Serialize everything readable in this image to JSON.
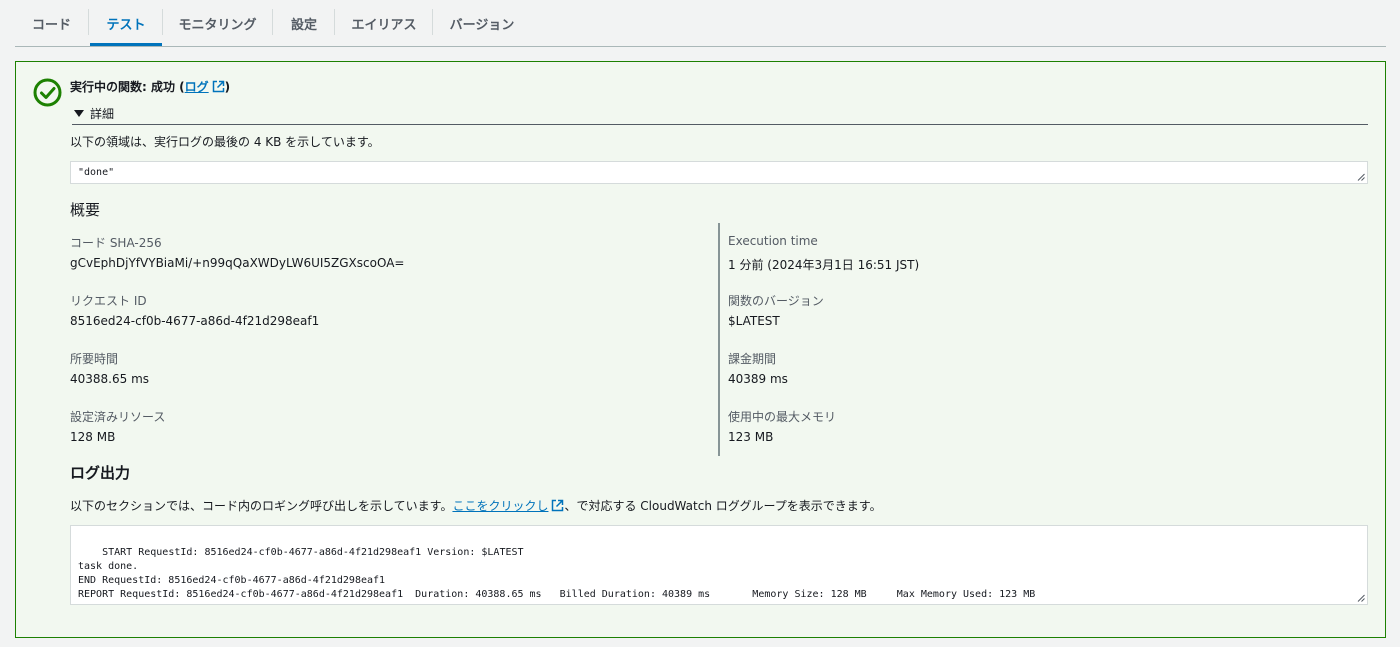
{
  "tabs": [
    {
      "label": "コード",
      "active": false
    },
    {
      "label": "テスト",
      "active": true
    },
    {
      "label": "モニタリング",
      "active": false
    },
    {
      "label": "設定",
      "active": false
    },
    {
      "label": "エイリアス",
      "active": false
    },
    {
      "label": "バージョン",
      "active": false
    }
  ],
  "result": {
    "status_prefix": "実行中の関数: 成功 (",
    "log_link": "ログ",
    "status_suffix": ")",
    "details_label": "詳細",
    "log_note": "以下の領域は、実行ログの最後の 4 KB を示しています。",
    "return_value": "\"done\""
  },
  "summary": {
    "title": "概要",
    "left": [
      {
        "label": "コード SHA-256",
        "value": "gCvEphDjYfVYBiaMi/+n99qQaXWDyLW6UI5ZGXscoOA="
      },
      {
        "label": "リクエスト ID",
        "value": "8516ed24-cf0b-4677-a86d-4f21d298eaf1"
      },
      {
        "label": "所要時間",
        "value": "40388.65 ms"
      },
      {
        "label": "設定済みリソース",
        "value": "128 MB"
      }
    ],
    "right": [
      {
        "label": "Execution time",
        "value": "1 分前 (2024年3月1日 16:51 JST)"
      },
      {
        "label": "関数のバージョン",
        "value": "$LATEST"
      },
      {
        "label": "課金期間",
        "value": "40389 ms"
      },
      {
        "label": "使用中の最大メモリ",
        "value": "123 MB"
      }
    ]
  },
  "log_output": {
    "title": "ログ出力",
    "desc_prefix": "以下のセクションでは、コード内のロギング呼び出しを示しています。",
    "desc_link": "ここをクリックし",
    "desc_suffix": "、で対応する CloudWatch ロググループを表示できます。",
    "text": "START RequestId: 8516ed24-cf0b-4677-a86d-4f21d298eaf1 Version: $LATEST\ntask done.\nEND RequestId: 8516ed24-cf0b-4677-a86d-4f21d298eaf1\nREPORT RequestId: 8516ed24-cf0b-4677-a86d-4f21d298eaf1  Duration: 40388.65 ms   Billed Duration: 40389 ms       Memory Size: 128 MB     Max Memory Used: 123 MB"
  },
  "colors": {
    "success": "#1d8102",
    "link": "#0073bb",
    "panel_bg": "#f2f8f0"
  },
  "icons": [
    "check-circle-icon",
    "external-link-icon",
    "caret-down-icon",
    "resize-handle-icon"
  ]
}
